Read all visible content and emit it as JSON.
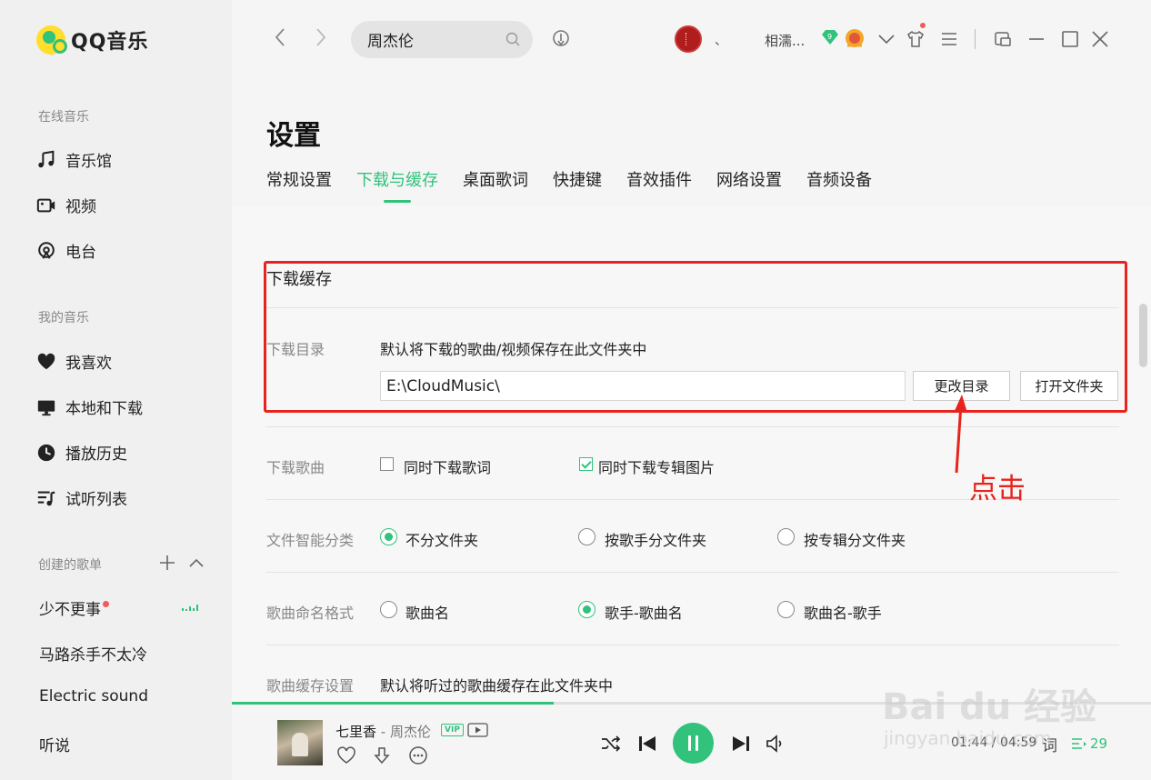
{
  "app": {
    "name": "QQ音乐"
  },
  "sidebar": {
    "online_title": "在线音乐",
    "online_items": [
      {
        "label": "音乐馆",
        "icon": "music-note-icon"
      },
      {
        "label": "视频",
        "icon": "video-icon"
      },
      {
        "label": "电台",
        "icon": "radio-icon"
      }
    ],
    "my_title": "我的音乐",
    "my_items": [
      {
        "label": "我喜欢",
        "icon": "heart-icon"
      },
      {
        "label": "本地和下载",
        "icon": "monitor-icon"
      },
      {
        "label": "播放历史",
        "icon": "history-icon"
      },
      {
        "label": "试听列表",
        "icon": "playlist-icon"
      }
    ],
    "created_title": "创建的歌单",
    "playlists": [
      "少不更事",
      "马路杀手不太冷",
      "Electric sound",
      "听说"
    ]
  },
  "header": {
    "search_value": "周杰伦",
    "user_comma": "、",
    "username": "相濡..."
  },
  "settings": {
    "title": "设置",
    "tabs": [
      "常规设置",
      "下载与缓存",
      "桌面歌词",
      "快捷键",
      "音效插件",
      "网络设置",
      "音频设备"
    ],
    "active_tab": 1,
    "section_title": "下载缓存",
    "download_dir": {
      "label": "下载目录",
      "desc": "默认将下载的歌曲/视频保存在此文件夹中",
      "path": "E:\\CloudMusic\\",
      "change_btn": "更改目录",
      "open_btn": "打开文件夹"
    },
    "download_song": {
      "label": "下载歌曲",
      "opt1": "同时下载歌词",
      "opt1_checked": false,
      "opt2": "同时下载专辑图片",
      "opt2_checked": true
    },
    "classify": {
      "label": "文件智能分类",
      "options": [
        "不分文件夹",
        "按歌手分文件夹",
        "按专辑分文件夹"
      ],
      "selected": 0
    },
    "naming": {
      "label": "歌曲命名格式",
      "options": [
        "歌曲名",
        "歌手-歌曲名",
        "歌曲名-歌手"
      ],
      "selected": 1
    },
    "cache": {
      "label": "歌曲缓存设置",
      "desc": "默认将听过的歌曲缓存在此文件夹中"
    }
  },
  "annotation": {
    "text": "点击",
    "color": "#e8231d"
  },
  "player": {
    "song": "七里香",
    "sep": " - ",
    "artist": "周杰伦",
    "vip": "VIP",
    "time": "01:44 / 04:59",
    "lyric": "词",
    "queue_count": "29",
    "progress": 0.35
  },
  "watermark": {
    "line1": "Bai du 经验",
    "line2": "jingyan.baidu.com"
  },
  "colors": {
    "accent": "#31c27c",
    "annotation": "#e8231d"
  }
}
